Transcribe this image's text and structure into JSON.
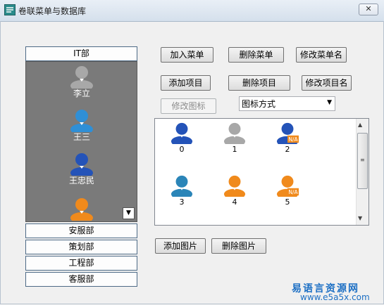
{
  "window": {
    "title": "卷联菜单与数据库",
    "close_label": "✕"
  },
  "groups": [
    {
      "label": "IT部",
      "expanded": true
    },
    {
      "label": "安服部"
    },
    {
      "label": "策划部"
    },
    {
      "label": "工程部"
    },
    {
      "label": "客服部"
    }
  ],
  "people": [
    {
      "name": "李立",
      "color": "#a8a8a8"
    },
    {
      "name": "王三",
      "color": "#2f8fd6"
    },
    {
      "name": "王忠民",
      "color": "#2453b8"
    },
    {
      "name": "",
      "color": "#f08a1c"
    }
  ],
  "buttons": {
    "add_menu": "加入菜单",
    "delete_menu": "删除菜单",
    "rename_menu": "修改菜单名",
    "add_item": "添加项目",
    "delete_item": "删除项目",
    "rename_item": "修改项目名",
    "change_icon": "修改图标",
    "add_image": "添加图片",
    "delete_image": "删除图片"
  },
  "icon_mode": {
    "selected": "图标方式"
  },
  "image_list": [
    {
      "label": "0",
      "color": "#2453b8",
      "badge": ""
    },
    {
      "label": "1",
      "color": "#a8a8a8",
      "badge": ""
    },
    {
      "label": "2",
      "color": "#2453b8",
      "badge": "N/A"
    },
    {
      "label": "3",
      "color": "#2b85b8",
      "badge": ""
    },
    {
      "label": "4",
      "color": "#f08a1c",
      "badge": ""
    },
    {
      "label": "5",
      "color": "#f08a1c",
      "badge": "N/A"
    }
  ],
  "watermark": {
    "line1": "易语言资源网",
    "line2": "www.e5a5x.com"
  }
}
